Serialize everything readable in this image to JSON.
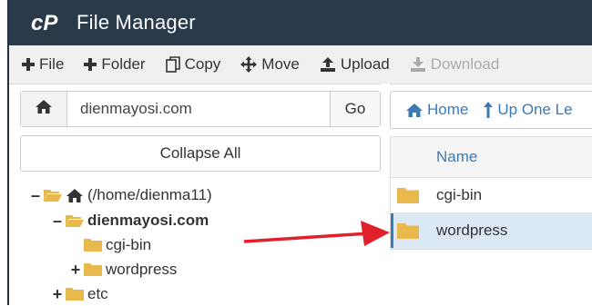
{
  "header": {
    "title": "File Manager",
    "logo_icon": "cpanel-logo-icon"
  },
  "toolbar": {
    "file": "File",
    "folder": "Folder",
    "copy": "Copy",
    "move": "Move",
    "upload": "Upload",
    "download": "Download"
  },
  "left": {
    "path_value": "dienmayosi.com",
    "go_label": "Go",
    "collapse_label": "Collapse All",
    "tree": [
      {
        "label": "(/home/dienma11)",
        "expanded": true
      },
      {
        "label": "dienmayosi.com",
        "expanded": true,
        "bold": true
      },
      {
        "label": "cgi-bin"
      },
      {
        "label": "wordpress",
        "expandable": true
      },
      {
        "label": "etc",
        "expandable": true
      }
    ]
  },
  "right": {
    "nav_home": "Home",
    "nav_up": "Up One Le",
    "column_name": "Name",
    "files": [
      {
        "name": "cgi-bin",
        "selected": false
      },
      {
        "name": "wordpress",
        "selected": true
      }
    ]
  },
  "colors": {
    "header_bg": "#293a4a",
    "folder": "#e8b84d",
    "link": "#3a7bb6",
    "selected_row": "#dbe9f6",
    "arrow": "#e0202a"
  }
}
